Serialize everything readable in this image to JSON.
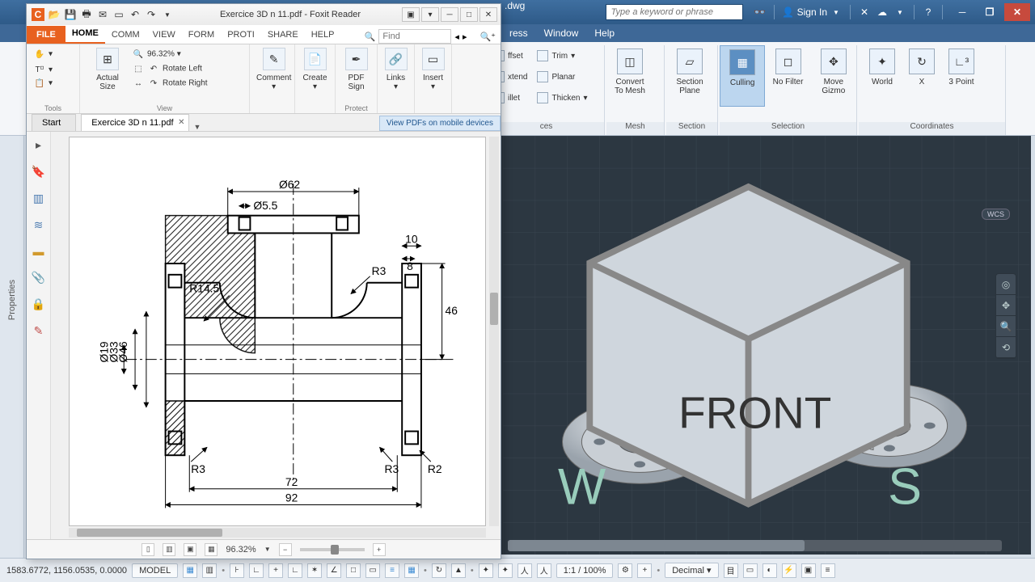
{
  "autocad": {
    "title_filename": ".dwg",
    "search_placeholder": "Type a keyword or phrase",
    "signin": "Sign In",
    "menubar": [
      "ress",
      "Window",
      "Help"
    ],
    "ribbon": {
      "modify": {
        "offset": "ffset",
        "extend": "xtend",
        "fillet": "illet",
        "trim": "Trim",
        "planar": "Planar",
        "thicken": "Thicken"
      },
      "convert": "Convert\nTo Mesh",
      "mesh_label": "Mesh",
      "section_plane": "Section\nPlane",
      "section_label": "Section",
      "culling": "Culling",
      "nofilter": "No Filter",
      "move_gizmo": "Move\nGizmo",
      "selection_label": "Selection",
      "world": "World",
      "x": "X",
      "threepoint": "3 Point",
      "coords_label": "Coordinates",
      "ces_label": "ces"
    },
    "wcs": "WCS",
    "status": {
      "coords": "1583.6772, 1156.0535, 0.0000",
      "model": "MODEL",
      "scale": "1:1 / 100%",
      "units": "Decimal"
    },
    "sidebar_label": "Properties"
  },
  "foxit": {
    "title": "Exercice 3D n 11.pdf - Foxit Reader",
    "tabs": {
      "file": "FILE",
      "home": "HOME",
      "comm": "COMM",
      "view": "VIEW",
      "form": "FORM",
      "prot": "PROTI",
      "share": "SHARE",
      "help": "HELP"
    },
    "find_placeholder": "Find",
    "ribbon": {
      "tools_label": "Tools",
      "actual_size": "Actual\nSize",
      "zoom_value": "96.32%",
      "rotate_left": "Rotate Left",
      "rotate_right": "Rotate Right",
      "view_label": "View",
      "comment": "Comment",
      "create": "Create",
      "pdf_sign": "PDF\nSign",
      "protect_label": "Protect",
      "links": "Links",
      "insert": "Insert"
    },
    "doctabs": {
      "start": "Start",
      "doc": "Exercice 3D n 11.pdf"
    },
    "promo": "View PDFs on mobile devices",
    "status_zoom": "96.32%",
    "drawing": {
      "d62": "Ø62",
      "d55": "Ø5.5",
      "r145": "R14.5",
      "r3a": "R3",
      "ten": "10",
      "eight": "8",
      "fortysix": "46",
      "d46": "Ø46",
      "d33": "Ø33",
      "d19": "Ø19",
      "r3b": "R3",
      "r3c": "R3",
      "r2": "R2",
      "seventytwo": "72",
      "ninetytwo": "92"
    }
  }
}
